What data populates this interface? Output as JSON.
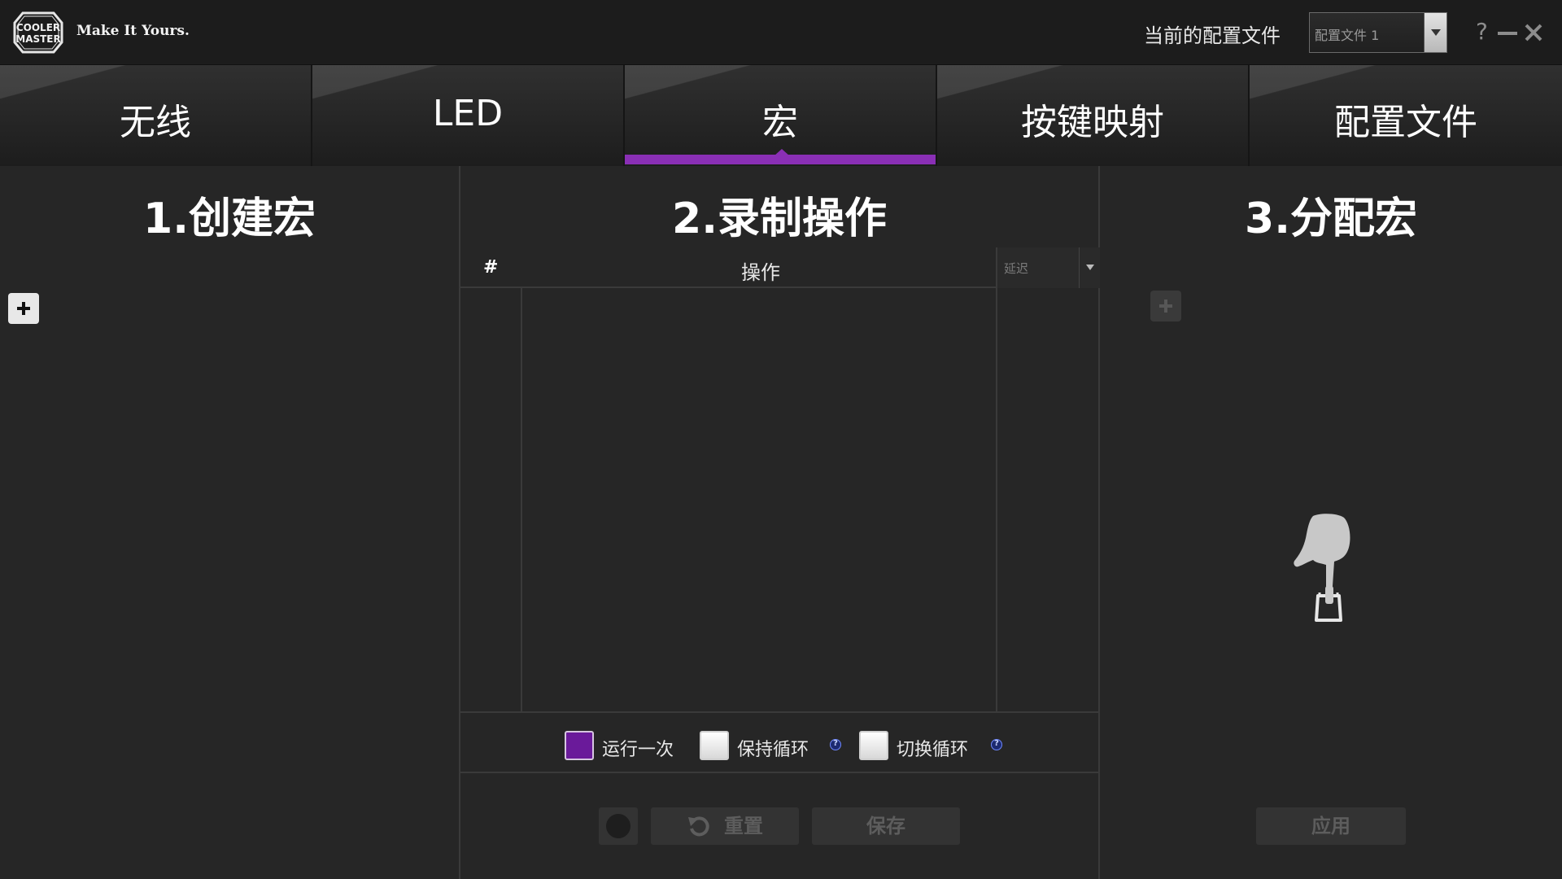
{
  "header": {
    "tagline": "Make It Yours.",
    "profile_label": "当前的配置文件",
    "profile_selected": "配置文件 1",
    "help": "?"
  },
  "tabs": [
    {
      "label": "无线",
      "active": false
    },
    {
      "label": "LED",
      "active": false
    },
    {
      "label": "宏",
      "active": true
    },
    {
      "label": "按键映射",
      "active": false
    },
    {
      "label": "配置文件",
      "active": false
    }
  ],
  "create_panel": {
    "title": "1.创建宏"
  },
  "record_panel": {
    "title": "2.录制操作",
    "col_index": "#",
    "col_action": "操作",
    "delay_selected": "延迟",
    "modes": [
      {
        "label": "运行一次",
        "checked": true
      },
      {
        "label": "保持循环",
        "checked": false,
        "help": "?"
      },
      {
        "label": "切换循环",
        "checked": false,
        "help": "?"
      }
    ],
    "reset_label": "重置",
    "save_label": "保存"
  },
  "assign_panel": {
    "title": "3.分配宏",
    "apply_label": "应用"
  },
  "colors": {
    "accent": "#8a2fb5",
    "background": "#262626",
    "topbar": "#1c1c1c",
    "disabled_text": "#5d5d5d"
  },
  "icons": [
    "cooler-master-logo",
    "dropdown-arrow-icon",
    "help-icon",
    "minimize-icon",
    "close-icon",
    "plus-icon",
    "record-icon",
    "reset-icon",
    "pointing-hand-icon"
  ]
}
